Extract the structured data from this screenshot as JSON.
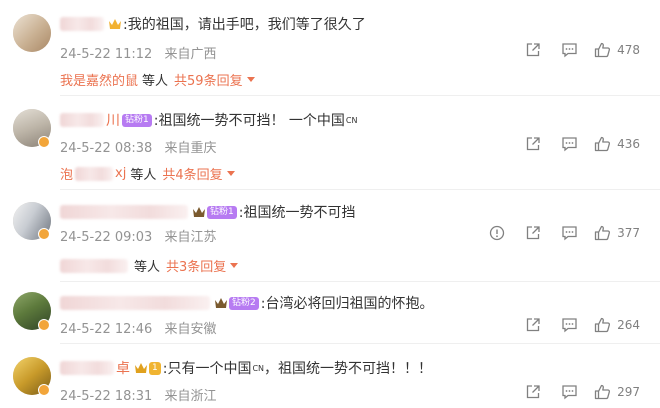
{
  "comments": [
    {
      "text": ":我的祖国，请出手吧，我们等了很久了",
      "date": "24-5-22 11:12",
      "location": "来自广西",
      "likes": "478",
      "reply": {
        "user": "我是嘉然的鼠",
        "etc": "等人",
        "link": "共59条回复"
      }
    },
    {
      "name_suffix": "川",
      "badge": "钻粉1",
      "text": ":祖国统一势不可挡！ 一个中国",
      "cn_mark": "CN",
      "date": "24-5-22 08:38",
      "location": "来自重庆",
      "likes": "436",
      "reply": {
        "user_prefix": "泡",
        "user_suffix": "xj",
        "etc": "等人",
        "link": "共4条回复"
      }
    },
    {
      "badge": "钻粉1",
      "text": ":祖国统一势不可挡",
      "date": "24-5-22 09:03",
      "location": "来自江苏",
      "likes": "377",
      "reply": {
        "etc": "等人",
        "link": "共3条回复"
      }
    },
    {
      "badge": "钻粉2",
      "text": ":台湾必将回归祖国的怀抱。",
      "date": "24-5-22 12:46",
      "location": "来自安徽",
      "likes": "264"
    },
    {
      "name_suffix": "卓",
      "badge": "1",
      "text": ":只有一个中国",
      "cn_mark": "CN",
      "text2": "，祖国统一势不可挡！！！",
      "date": "24-5-22 18:31",
      "location": "来自浙江",
      "likes": "297"
    }
  ],
  "colors": {
    "link": "#eb7350",
    "meta": "#939393",
    "badge_purple": "#b77bf2",
    "badge_gold": "#f0b431"
  },
  "icons": [
    "share-icon",
    "comment-icon",
    "like-icon",
    "crown-icon",
    "verified-badge-icon",
    "dropdown-triangle-icon"
  ]
}
